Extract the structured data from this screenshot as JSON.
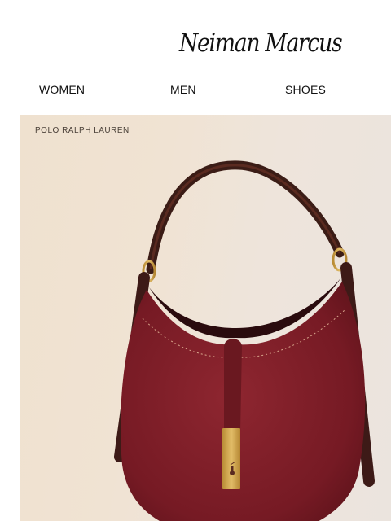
{
  "header": {
    "logo_text": "Neiman Marcus"
  },
  "nav": {
    "items": [
      "WOMEN",
      "MEN",
      "SHOES"
    ]
  },
  "hero": {
    "brand": "POLO RALPH LAUREN",
    "product_icon": "suede-hobo-bag-image",
    "colors": {
      "bag": "#7a1a22",
      "strap": "#3b1c16",
      "hardware": "#c9a14a"
    }
  }
}
